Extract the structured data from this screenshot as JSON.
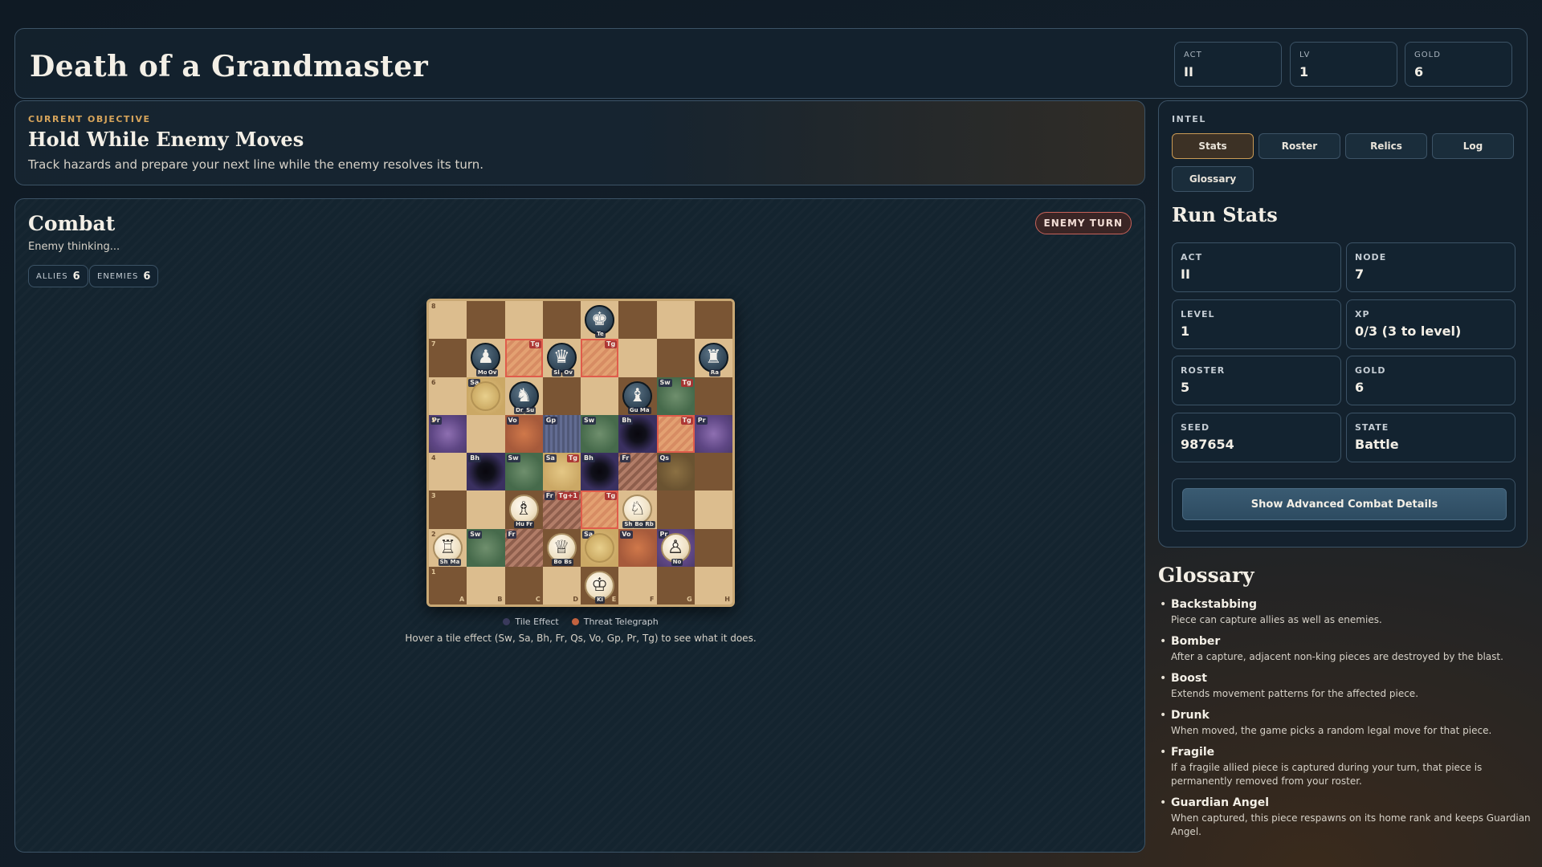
{
  "header": {
    "title": "Death of a Grandmaster",
    "stats": [
      {
        "label": "ACT",
        "value": "II"
      },
      {
        "label": "LV",
        "value": "1"
      },
      {
        "label": "GOLD",
        "value": "6"
      }
    ]
  },
  "objective": {
    "label": "CURRENT OBJECTIVE",
    "title": "Hold While Enemy Moves",
    "description": "Track hazards and prepare your next line while the enemy resolves its turn."
  },
  "combat": {
    "title": "Combat",
    "subtitle": "Enemy thinking...",
    "allies_label": "ALLIES",
    "allies_count": "6",
    "enemies_label": "ENEMIES",
    "enemies_count": "6",
    "turn_badge": "ENEMY TURN",
    "legend_tile": "Tile Effect",
    "legend_threat": "Threat Telegraph",
    "legend_tile_color": "#3a3a5c",
    "legend_threat_color": "#c2623f",
    "hover_hint": "Hover a tile effect (Sw, Sa, Bh, Fr, Qs, Vo, Gp, Pr, Tg) to see what it does.",
    "board": {
      "ranks": [
        "8",
        "7",
        "6",
        "5",
        "4",
        "3",
        "2",
        "1"
      ],
      "files": [
        "A",
        "B",
        "C",
        "D",
        "E",
        "F",
        "G",
        "H"
      ],
      "tiles": [
        {
          "sq": "c7",
          "fx": "tg"
        },
        {
          "sq": "e7",
          "fx": "tg"
        },
        {
          "sq": "b6",
          "fx": "sa"
        },
        {
          "sq": "g6",
          "fx": "sw",
          "extra": "tg"
        },
        {
          "sq": "a5",
          "fx": "pr"
        },
        {
          "sq": "c5",
          "fx": "vo"
        },
        {
          "sq": "d5",
          "fx": "gp"
        },
        {
          "sq": "e5",
          "fx": "sw"
        },
        {
          "sq": "f5",
          "fx": "bh"
        },
        {
          "sq": "g5",
          "fx": "tg"
        },
        {
          "sq": "h5",
          "fx": "pr"
        },
        {
          "sq": "b4",
          "fx": "bh"
        },
        {
          "sq": "c4",
          "fx": "sw"
        },
        {
          "sq": "d4",
          "fx": "sa",
          "extra": "tg"
        },
        {
          "sq": "e4",
          "fx": "bh"
        },
        {
          "sq": "f4",
          "fx": "fr"
        },
        {
          "sq": "g4",
          "fx": "qs"
        },
        {
          "sq": "d3",
          "fx": "fr",
          "extra": "tg",
          "extra_label": "Tg+1"
        },
        {
          "sq": "e3",
          "fx": "tg"
        },
        {
          "sq": "b2",
          "fx": "sw"
        },
        {
          "sq": "c2",
          "fx": "fr"
        },
        {
          "sq": "e2",
          "fx": "sa"
        },
        {
          "sq": "f2",
          "fx": "vo"
        },
        {
          "sq": "g2",
          "fx": "pr"
        }
      ],
      "pieces": [
        {
          "sq": "e8",
          "side": "enemy",
          "glyph": "♚",
          "mods": [
            "Te"
          ]
        },
        {
          "sq": "b7",
          "side": "enemy",
          "glyph": "♟",
          "mods": [
            "Mo",
            "Ov"
          ]
        },
        {
          "sq": "d7",
          "side": "enemy",
          "glyph": "♛",
          "mods": [
            "Sl",
            "Ov"
          ]
        },
        {
          "sq": "h7",
          "side": "enemy",
          "glyph": "♜",
          "mods": [
            "Ra"
          ]
        },
        {
          "sq": "c6",
          "side": "enemy",
          "glyph": "♞",
          "mods": [
            "Dr",
            "Su"
          ]
        },
        {
          "sq": "f6",
          "side": "enemy",
          "glyph": "♝",
          "mods": [
            "Gu",
            "Ma"
          ]
        },
        {
          "sq": "c3",
          "side": "ally",
          "glyph": "♗",
          "mods": [
            "Hu",
            "Fr"
          ]
        },
        {
          "sq": "f3",
          "side": "ally",
          "glyph": "♘",
          "mods": [
            "Sh",
            "Bo",
            "Rb"
          ]
        },
        {
          "sq": "a2",
          "side": "ally",
          "glyph": "♖",
          "mods": [
            "Sh",
            "Ma"
          ]
        },
        {
          "sq": "d2",
          "side": "ally",
          "glyph": "♕",
          "mods": [
            "Bo",
            "Bs"
          ]
        },
        {
          "sq": "g2",
          "side": "ally",
          "glyph": "♙",
          "mods": [
            "No"
          ]
        },
        {
          "sq": "e1",
          "side": "ally",
          "glyph": "♔",
          "mods": [
            "Ki"
          ]
        }
      ],
      "ghosts": [
        "b6",
        "e2"
      ]
    }
  },
  "intel": {
    "label": "INTEL",
    "tabs": [
      {
        "label": "Stats",
        "active": true
      },
      {
        "label": "Roster",
        "active": false
      },
      {
        "label": "Relics",
        "active": false
      },
      {
        "label": "Log",
        "active": false
      },
      {
        "label": "Glossary",
        "active": false
      }
    ],
    "run_stats_title": "Run Stats",
    "stats": [
      {
        "label": "ACT",
        "value": "II"
      },
      {
        "label": "NODE",
        "value": "7"
      },
      {
        "label": "LEVEL",
        "value": "1"
      },
      {
        "label": "XP",
        "value": "0/3 (3 to level)"
      },
      {
        "label": "ROSTER",
        "value": "5"
      },
      {
        "label": "GOLD",
        "value": "6"
      },
      {
        "label": "SEED",
        "value": "987654"
      },
      {
        "label": "STATE",
        "value": "Battle"
      }
    ],
    "advanced_button": "Show Advanced Combat Details"
  },
  "glossary": {
    "title": "Glossary",
    "items": [
      {
        "name": "Backstabbing",
        "desc": "Piece can capture allies as well as enemies."
      },
      {
        "name": "Bomber",
        "desc": "After a capture, adjacent non-king pieces are destroyed by the blast."
      },
      {
        "name": "Boost",
        "desc": "Extends movement patterns for the affected piece."
      },
      {
        "name": "Drunk",
        "desc": "When moved, the game picks a random legal move for that piece."
      },
      {
        "name": "Fragile",
        "desc": "If a fragile allied piece is captured during your turn, that piece is permanently removed from your roster."
      },
      {
        "name": "Guardian Angel",
        "desc": "When captured, this piece respawns on its home rank and keeps Guardian Angel."
      }
    ]
  }
}
